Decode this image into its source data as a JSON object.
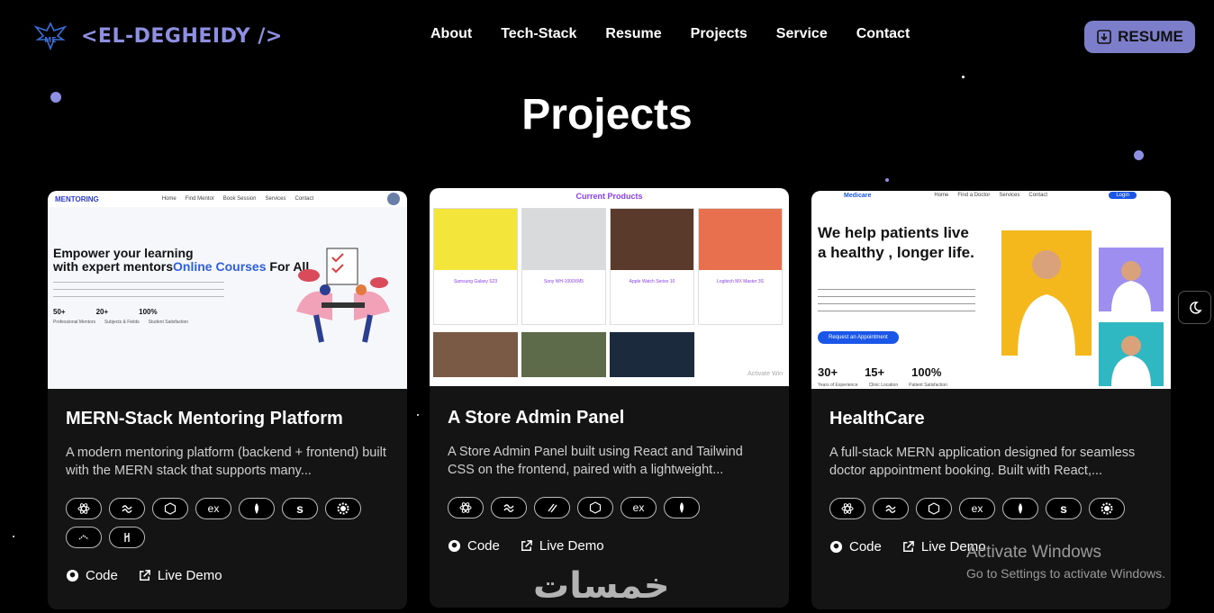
{
  "header": {
    "brand": "<EL-DEGHEIDY />",
    "nav": [
      "About",
      "Tech-Stack",
      "Resume",
      "Projects",
      "Service",
      "Contact"
    ],
    "resume_label": "RESUME"
  },
  "section_title": "Projects",
  "projects": [
    {
      "title": "MERN-Stack Mentoring Platform",
      "desc": "A modern mentoring platform (backend + frontend) built with the MERN stack that supports many...",
      "tags": [
        "react-icon",
        "tailwind-icon",
        "nodejs-icon",
        "ex",
        "mongodb-icon",
        "s",
        "gear-icon",
        "stack-icon",
        "vercel-icon"
      ],
      "code_label": "Code",
      "demo_label": "Live Demo",
      "preview": {
        "brand": "MENTORING",
        "menu": [
          "Home",
          "Find Mentor",
          "Book Session",
          "Services",
          "Contact"
        ],
        "headline_1": "Empower your learning",
        "headline_2": "with expert mentors",
        "headline_accent": "Online Courses",
        "headline_3": "For All",
        "stats": [
          "50+",
          "20+",
          "100%"
        ],
        "stat_labels": [
          "Professional Mentors",
          "Subjects & Fields",
          "Student Satisfaction"
        ]
      }
    },
    {
      "title": "A Store Admin Panel",
      "desc": "A Store Admin Panel built using React and Tailwind CSS on the frontend, paired with a lightweight...",
      "tags": [
        "react-icon",
        "tailwind-icon",
        "slash-icon",
        "nodejs-icon",
        "ex",
        "mongodb-icon"
      ],
      "code_label": "Code",
      "demo_label": "Live Demo",
      "preview": {
        "heading": "Current Products",
        "products": [
          "Samsung Galaxy S23",
          "Sony WH-1000XM5",
          "Apple Watch Series 10",
          "Logitech MX Master 3S"
        ],
        "watermark": "Activate Win"
      }
    },
    {
      "title": "HealthCare",
      "desc": "A full-stack MERN application designed for seamless doctor appointment booking. Built with React,...",
      "tags": [
        "react-icon",
        "tailwind-icon",
        "nodejs-icon",
        "ex",
        "mongodb-icon",
        "s",
        "gear-icon"
      ],
      "code_label": "Code",
      "demo_label": "Live Demo",
      "preview": {
        "brand": "Medicare",
        "menu": [
          "Home",
          "Find a Doctor",
          "Services",
          "Contact"
        ],
        "login": "Login",
        "headline": "We help patients live a healthy , longer life.",
        "cta": "Request an Appointment",
        "stats": [
          "30+",
          "15+",
          "100%"
        ],
        "stat_labels": [
          "Years of Experience",
          "Clinic Location",
          "Patient Satisfaction"
        ]
      }
    }
  ],
  "overlay": {
    "windows_title": "Activate Windows",
    "windows_sub": "Go to Settings to activate Windows.",
    "arabic": "خمسات"
  }
}
